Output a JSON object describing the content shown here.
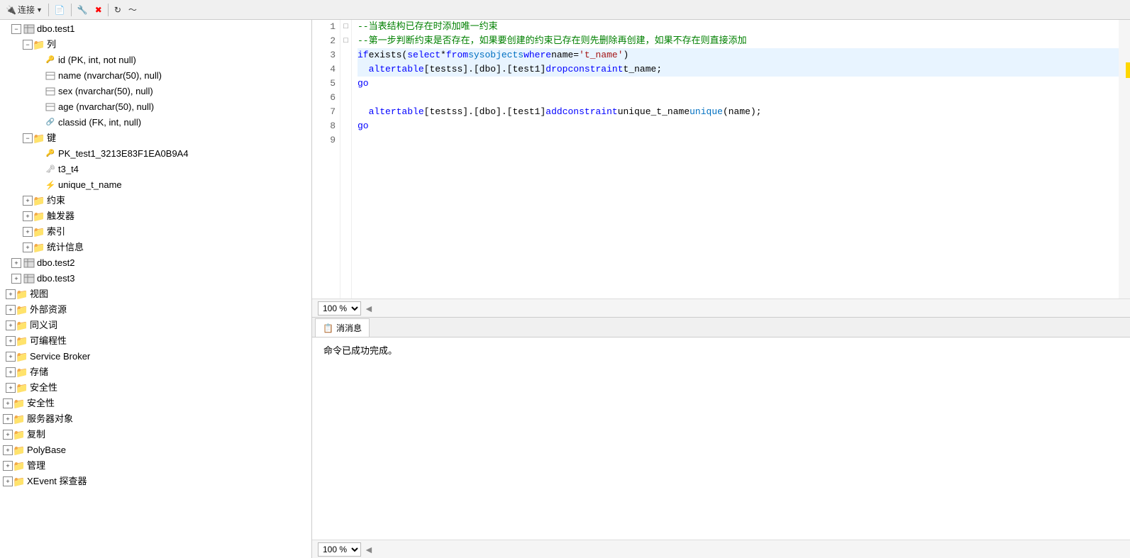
{
  "toolbar": {
    "connect_label": "连接",
    "buttons": [
      "connect",
      "new-query",
      "filter",
      "filter2",
      "refresh",
      "activity"
    ]
  },
  "tree": {
    "items": [
      {
        "id": "dbo-test1",
        "label": "dbo.test1",
        "level": 1,
        "type": "table",
        "expanded": true,
        "icon": "table"
      },
      {
        "id": "columns",
        "label": "列",
        "level": 2,
        "type": "folder",
        "expanded": true,
        "icon": "folder"
      },
      {
        "id": "col-id",
        "label": "id (PK, int, not null)",
        "level": 3,
        "type": "pk-column",
        "icon": "pk"
      },
      {
        "id": "col-name",
        "label": "name (nvarchar(50), null)",
        "level": 3,
        "type": "column",
        "icon": "column"
      },
      {
        "id": "col-sex",
        "label": "sex (nvarchar(50), null)",
        "level": 3,
        "type": "column",
        "icon": "column"
      },
      {
        "id": "col-age",
        "label": "age (nvarchar(50), null)",
        "level": 3,
        "type": "column",
        "icon": "column"
      },
      {
        "id": "col-classid",
        "label": "classid (FK, int, null)",
        "level": 3,
        "type": "fk-column",
        "icon": "fk"
      },
      {
        "id": "keys",
        "label": "键",
        "level": 2,
        "type": "folder",
        "expanded": true,
        "icon": "folder"
      },
      {
        "id": "key-pk",
        "label": "PK_test1_3213E83F1EA0B9A4",
        "level": 3,
        "type": "pk",
        "icon": "pk"
      },
      {
        "id": "key-t3t4",
        "label": "t3_t4",
        "level": 3,
        "type": "fk",
        "icon": "fk"
      },
      {
        "id": "key-unique",
        "label": "unique_t_name",
        "level": 3,
        "type": "unique",
        "icon": "unique"
      },
      {
        "id": "constraints",
        "label": "约束",
        "level": 2,
        "type": "folder",
        "expanded": false,
        "icon": "folder"
      },
      {
        "id": "triggers",
        "label": "触发器",
        "level": 2,
        "type": "folder",
        "expanded": false,
        "icon": "folder"
      },
      {
        "id": "indexes",
        "label": "索引",
        "level": 2,
        "type": "folder",
        "expanded": false,
        "icon": "folder"
      },
      {
        "id": "statistics",
        "label": "统计信息",
        "level": 2,
        "type": "folder",
        "expanded": false,
        "icon": "folder"
      },
      {
        "id": "dbo-test2",
        "label": "dbo.test2",
        "level": 1,
        "type": "table",
        "expanded": false,
        "icon": "table"
      },
      {
        "id": "dbo-test3",
        "label": "dbo.test3",
        "level": 1,
        "type": "table",
        "expanded": false,
        "icon": "table"
      },
      {
        "id": "views",
        "label": "视图",
        "level": 0,
        "type": "folder",
        "expanded": false,
        "icon": "folder"
      },
      {
        "id": "external",
        "label": "外部资源",
        "level": 0,
        "type": "folder",
        "expanded": false,
        "icon": "folder"
      },
      {
        "id": "synonyms",
        "label": "同义词",
        "level": 0,
        "type": "folder",
        "expanded": false,
        "icon": "folder"
      },
      {
        "id": "programmability",
        "label": "可编程性",
        "level": 0,
        "type": "folder",
        "expanded": false,
        "icon": "folder"
      },
      {
        "id": "service-broker",
        "label": "Service Broker",
        "level": 0,
        "type": "folder",
        "expanded": false,
        "icon": "folder"
      },
      {
        "id": "storage",
        "label": "存储",
        "level": 0,
        "type": "folder",
        "expanded": false,
        "icon": "folder"
      },
      {
        "id": "security-db",
        "label": "安全性",
        "level": 0,
        "type": "folder",
        "expanded": false,
        "icon": "folder"
      },
      {
        "id": "security-top",
        "label": "安全性",
        "level": -1,
        "type": "folder",
        "expanded": false,
        "icon": "folder"
      },
      {
        "id": "server-objects",
        "label": "服务器对象",
        "level": -1,
        "type": "folder",
        "expanded": false,
        "icon": "folder"
      },
      {
        "id": "replication",
        "label": "复制",
        "level": -1,
        "type": "folder",
        "expanded": false,
        "icon": "folder"
      },
      {
        "id": "polybase",
        "label": "PolyBase",
        "level": -1,
        "type": "folder",
        "expanded": false,
        "icon": "folder"
      },
      {
        "id": "management",
        "label": "管理",
        "level": -1,
        "type": "folder",
        "expanded": false,
        "icon": "folder"
      },
      {
        "id": "xevent",
        "label": "XEvent 探查器",
        "level": -1,
        "type": "folder",
        "expanded": false,
        "icon": "folder"
      }
    ]
  },
  "editor": {
    "zoom": "100 %",
    "lines": [
      {
        "num": 1,
        "marker": "□",
        "tokens": [
          {
            "type": "cm",
            "text": "--当表结构已存在时添加唯一约束"
          }
        ]
      },
      {
        "num": 2,
        "marker": "",
        "tokens": [
          {
            "type": "cm",
            "text": "--第一步判断约束是否存在，如果要创建的约束已存在则先删除再创建，如果不存在则直接添加"
          }
        ]
      },
      {
        "num": 3,
        "marker": "□",
        "tokens": [
          {
            "type": "kw",
            "text": "if"
          },
          {
            "type": "plain",
            "text": " exists("
          },
          {
            "type": "kw",
            "text": "select"
          },
          {
            "type": "plain",
            "text": " * "
          },
          {
            "type": "kw",
            "text": "from"
          },
          {
            "type": "plain",
            "text": " "
          },
          {
            "type": "fn",
            "text": "sysobjects"
          },
          {
            "type": "plain",
            "text": " "
          },
          {
            "type": "kw",
            "text": "where"
          },
          {
            "type": "plain",
            "text": " name="
          },
          {
            "type": "st",
            "text": "'t_name'"
          },
          {
            "type": "plain",
            "text": ")"
          }
        ]
      },
      {
        "num": 4,
        "marker": "",
        "tokens": [
          {
            "type": "plain",
            "text": "  "
          },
          {
            "type": "kw",
            "text": "alter"
          },
          {
            "type": "plain",
            "text": " "
          },
          {
            "type": "kw",
            "text": "table"
          },
          {
            "type": "plain",
            "text": " [testss].[dbo].[test1] "
          },
          {
            "type": "kw",
            "text": "drop"
          },
          {
            "type": "plain",
            "text": " "
          },
          {
            "type": "kw",
            "text": "constraint"
          },
          {
            "type": "plain",
            "text": " t_name;"
          }
        ]
      },
      {
        "num": 5,
        "marker": "",
        "tokens": [
          {
            "type": "kw",
            "text": "go"
          }
        ]
      },
      {
        "num": 6,
        "marker": "",
        "tokens": []
      },
      {
        "num": 7,
        "marker": "",
        "tokens": [
          {
            "type": "plain",
            "text": "  "
          },
          {
            "type": "kw",
            "text": "alter"
          },
          {
            "type": "plain",
            "text": " "
          },
          {
            "type": "kw",
            "text": "table"
          },
          {
            "type": "plain",
            "text": " [testss].[dbo].[test1] "
          },
          {
            "type": "kw",
            "text": "add"
          },
          {
            "type": "plain",
            "text": " "
          },
          {
            "type": "kw",
            "text": "constraint"
          },
          {
            "type": "plain",
            "text": " unique_t_name "
          },
          {
            "type": "fn",
            "text": "unique"
          },
          {
            "type": "plain",
            "text": "(name);"
          }
        ]
      },
      {
        "num": 8,
        "marker": "",
        "tokens": [
          {
            "type": "kw",
            "text": "go"
          }
        ]
      },
      {
        "num": 9,
        "marker": "",
        "tokens": []
      }
    ]
  },
  "results": {
    "tab_label": "消消息",
    "tab_icon": "message-icon",
    "message": "命令已成功完成。",
    "zoom": "100 %"
  }
}
